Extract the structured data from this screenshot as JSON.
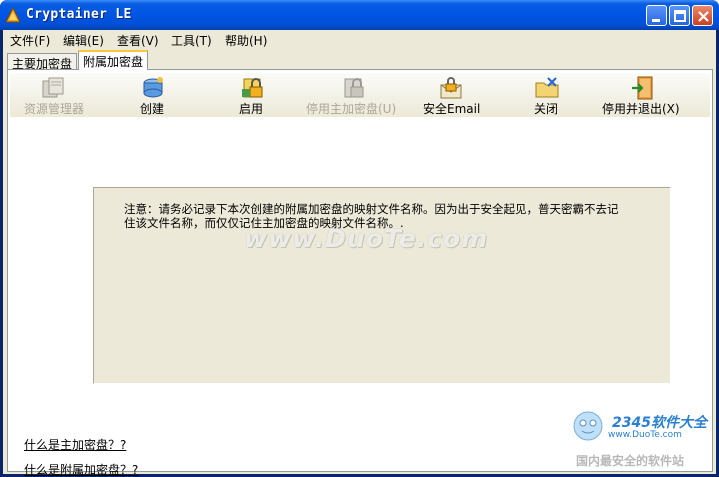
{
  "window": {
    "title": "Cryptainer LE"
  },
  "menu": [
    {
      "label": "文件(F)"
    },
    {
      "label": "编辑(E)"
    },
    {
      "label": "查看(V)"
    },
    {
      "label": "工具(T)"
    },
    {
      "label": "帮助(H)"
    }
  ],
  "tabs": [
    {
      "label": "主要加密盘",
      "active": false
    },
    {
      "label": "附属加密盘",
      "active": true
    }
  ],
  "toolbar": [
    {
      "label": "资源管理器",
      "icon": "explorer-icon",
      "enabled": false
    },
    {
      "label": "创建",
      "icon": "create-disk-icon",
      "enabled": true
    },
    {
      "label": "启用",
      "icon": "enable-lock-icon",
      "enabled": true
    },
    {
      "label": "停用主加密盘(U)",
      "icon": "disable-main-icon",
      "enabled": false
    },
    {
      "label": "安全Email",
      "icon": "secure-email-icon",
      "enabled": true
    },
    {
      "label": "关闭",
      "icon": "close-folder-icon",
      "enabled": true
    },
    {
      "label": "停用并退出(X)",
      "icon": "exit-door-icon",
      "enabled": true
    }
  ],
  "notice": {
    "line1": "注意：请务必记录下本次创建的附属加密盘的映射文件名称。因为出于安全起见，普天密霸不去记",
    "line2": "住该文件名称，而仅仅记住主加密盘的映射文件名称。.",
    "watermark": "www.DuoTe.com"
  },
  "links": [
    {
      "label": "什么是主加密盘？?"
    },
    {
      "label": "什么是附属加密盘？?"
    }
  ],
  "corner_logo": {
    "brand": "2345软件大全",
    "url": "www.DuoTe.com",
    "slogan": "国内最安全的软件站"
  },
  "colors": {
    "titlebar": "#0055e5",
    "face": "#ece9d8",
    "tab_highlight": "#ffc83c"
  }
}
